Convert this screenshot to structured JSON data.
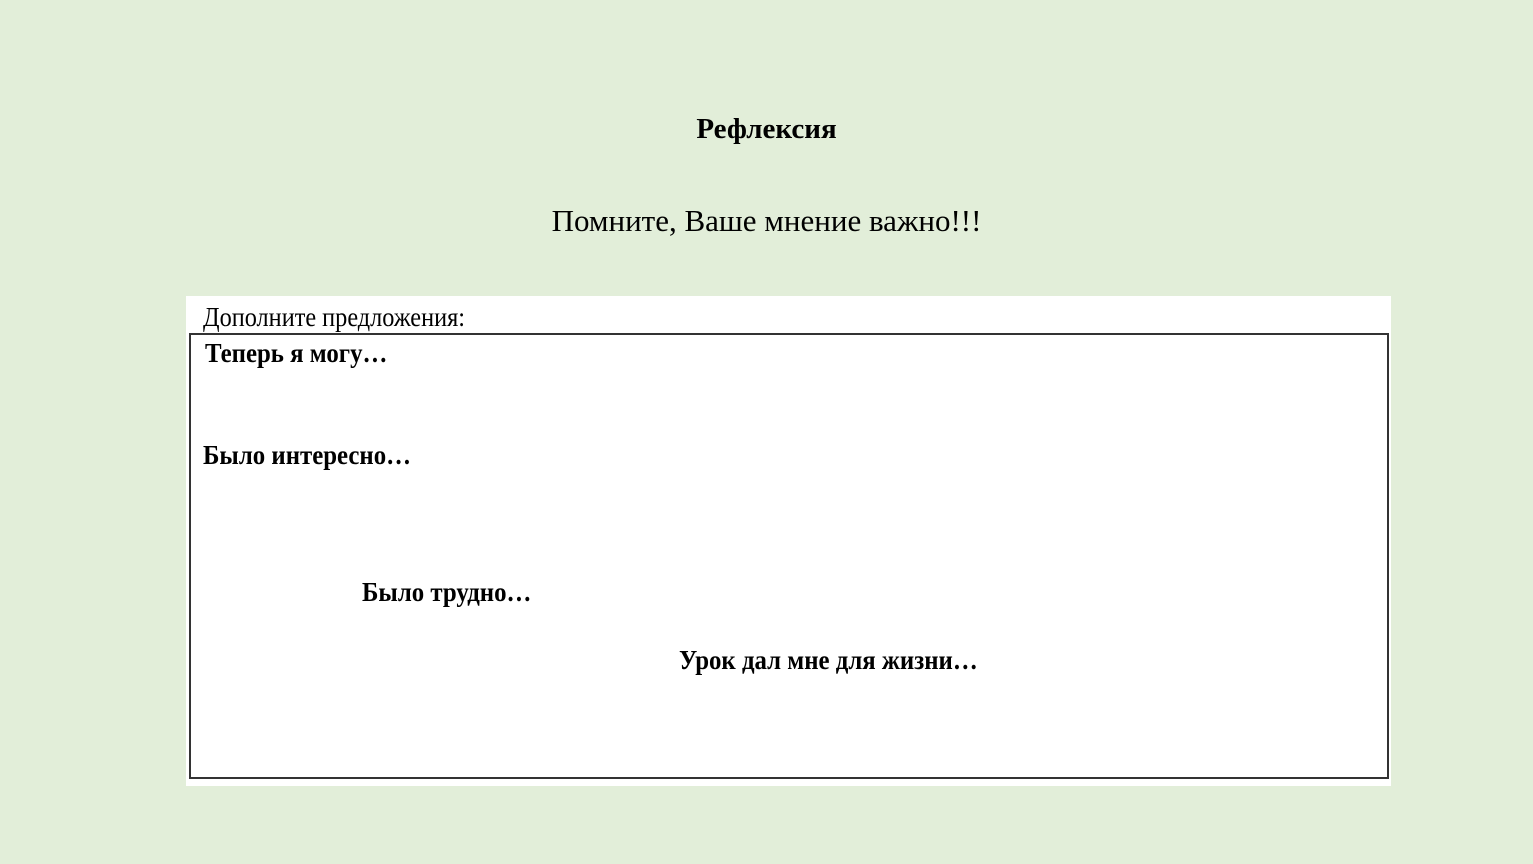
{
  "slide": {
    "title": "Рефлексия",
    "subtitle": "Помните, Ваше мнение важно!!!",
    "panel": {
      "heading": "Дополните предложения:",
      "prompts": [
        "Теперь я могу…",
        "Было интересно…",
        "Было трудно…",
        "Урок дал мне для жизни…"
      ]
    }
  }
}
